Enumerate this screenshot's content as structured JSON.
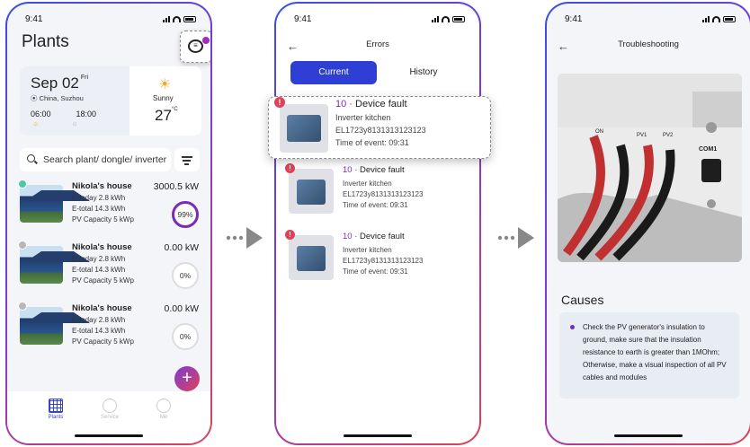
{
  "status": {
    "time": "9:41"
  },
  "plants_screen": {
    "title": "Plants",
    "weather": {
      "date": "Sep 02",
      "weekday": "Fri",
      "location": "China, Suzhou",
      "sunrise": "06:00",
      "sunset": "18:00",
      "condition": "Sunny",
      "temp": "27",
      "temp_unit": "°C"
    },
    "search_placeholder": "Search plant/ dongle/ inverter",
    "plants": [
      {
        "name": "Nikola's house",
        "today": "E-today 2.8 kWh",
        "total": "E-total 14.3 kWh",
        "capacity": "PV Capacity  5 kWp",
        "power": "3000.5 kW",
        "percent": "99%",
        "status": "online"
      },
      {
        "name": "Nikola's house",
        "today": "E-today 2.8 kWh",
        "total": "E-total 14.3 kWh",
        "capacity": "PV Capacity  5 kWp",
        "power": "0.00 kW",
        "percent": "0%",
        "status": "offline"
      },
      {
        "name": "Nikola's house",
        "today": "E-today 2.8 kWh",
        "total": "E-total 14.3 kWh",
        "capacity": "PV Capacity  5 kWp",
        "power": "0.00 kW",
        "percent": "0%",
        "status": "offline"
      }
    ],
    "tabs": [
      {
        "label": "Plants"
      },
      {
        "label": "Service"
      },
      {
        "label": "Me"
      }
    ],
    "fab": "+"
  },
  "errors_screen": {
    "title": "Errors",
    "segments": {
      "current": "Current",
      "history": "History"
    },
    "errors": [
      {
        "code": "10",
        "title": "Device fault",
        "device": "Inverter kitchen",
        "serial": "EL1723y8131313123123",
        "time": "Time of event: 09:31"
      },
      {
        "code": "10",
        "title": "Device fault",
        "device": "Inverter kitchen",
        "serial": "EL1723y8131313123123",
        "time": "Time of event: 09:31"
      },
      {
        "code": "10",
        "title": "Device fault",
        "device": "Inverter kitchen",
        "serial": "EL1723y8131313123123",
        "time": "Time of event: 09:31"
      }
    ],
    "sep": " · "
  },
  "trouble_screen": {
    "title": "Troubleshooting",
    "causes_heading": "Causes",
    "cause_text": "Check the PV generator's insulation to ground, make sure that the insulation resistance to earth is greater than 1MOhm; Otherwise, make a visual inspection of all PV cables and modules",
    "photo_labels": {
      "on": "ON",
      "pv1": "PV1",
      "pv2": "PV2",
      "com": "COM1"
    }
  },
  "colors": {
    "accent": "#2f3fd6",
    "purple": "#7a2bb3",
    "alert": "#e0415a"
  }
}
